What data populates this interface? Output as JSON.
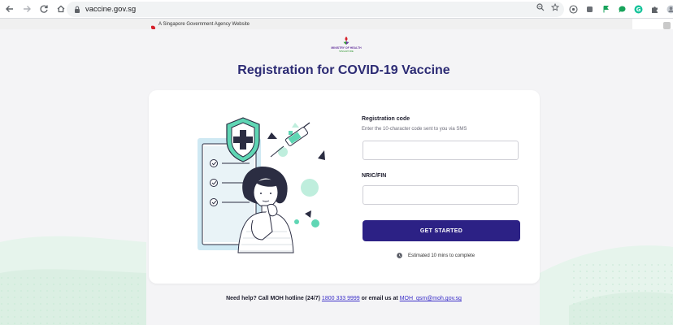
{
  "browser": {
    "url": "vaccine.gov.sg",
    "back_icon": "arrow-left-icon",
    "forward_icon": "arrow-right-icon",
    "reload_icon": "reload-icon",
    "home_icon": "home-icon"
  },
  "masthead": {
    "text": "A Singapore Government Agency Website"
  },
  "logo": {
    "line1": "MINISTRY OF HEALTH",
    "line2": "SINGAPORE"
  },
  "page": {
    "title": "Registration for COVID-19 Vaccine"
  },
  "form": {
    "registration_label": "Registration code",
    "registration_help": "Enter the 10-character code sent to you via SMS",
    "registration_value": "",
    "nric_label": "NRIC/FIN",
    "nric_value": "",
    "submit_label": "GET STARTED",
    "estimate_text": "Estimated 10 mins to complete"
  },
  "help": {
    "prefix": "Need help? Call MOH hotline (24/7)",
    "phone": "1800 333 9999",
    "middle": "or email us at",
    "email": "MOH_qsm@moh.gov.sg"
  },
  "colors": {
    "brand": "#2c2185",
    "title": "#2c2b74",
    "accent_teal": "#5fd6b4"
  }
}
